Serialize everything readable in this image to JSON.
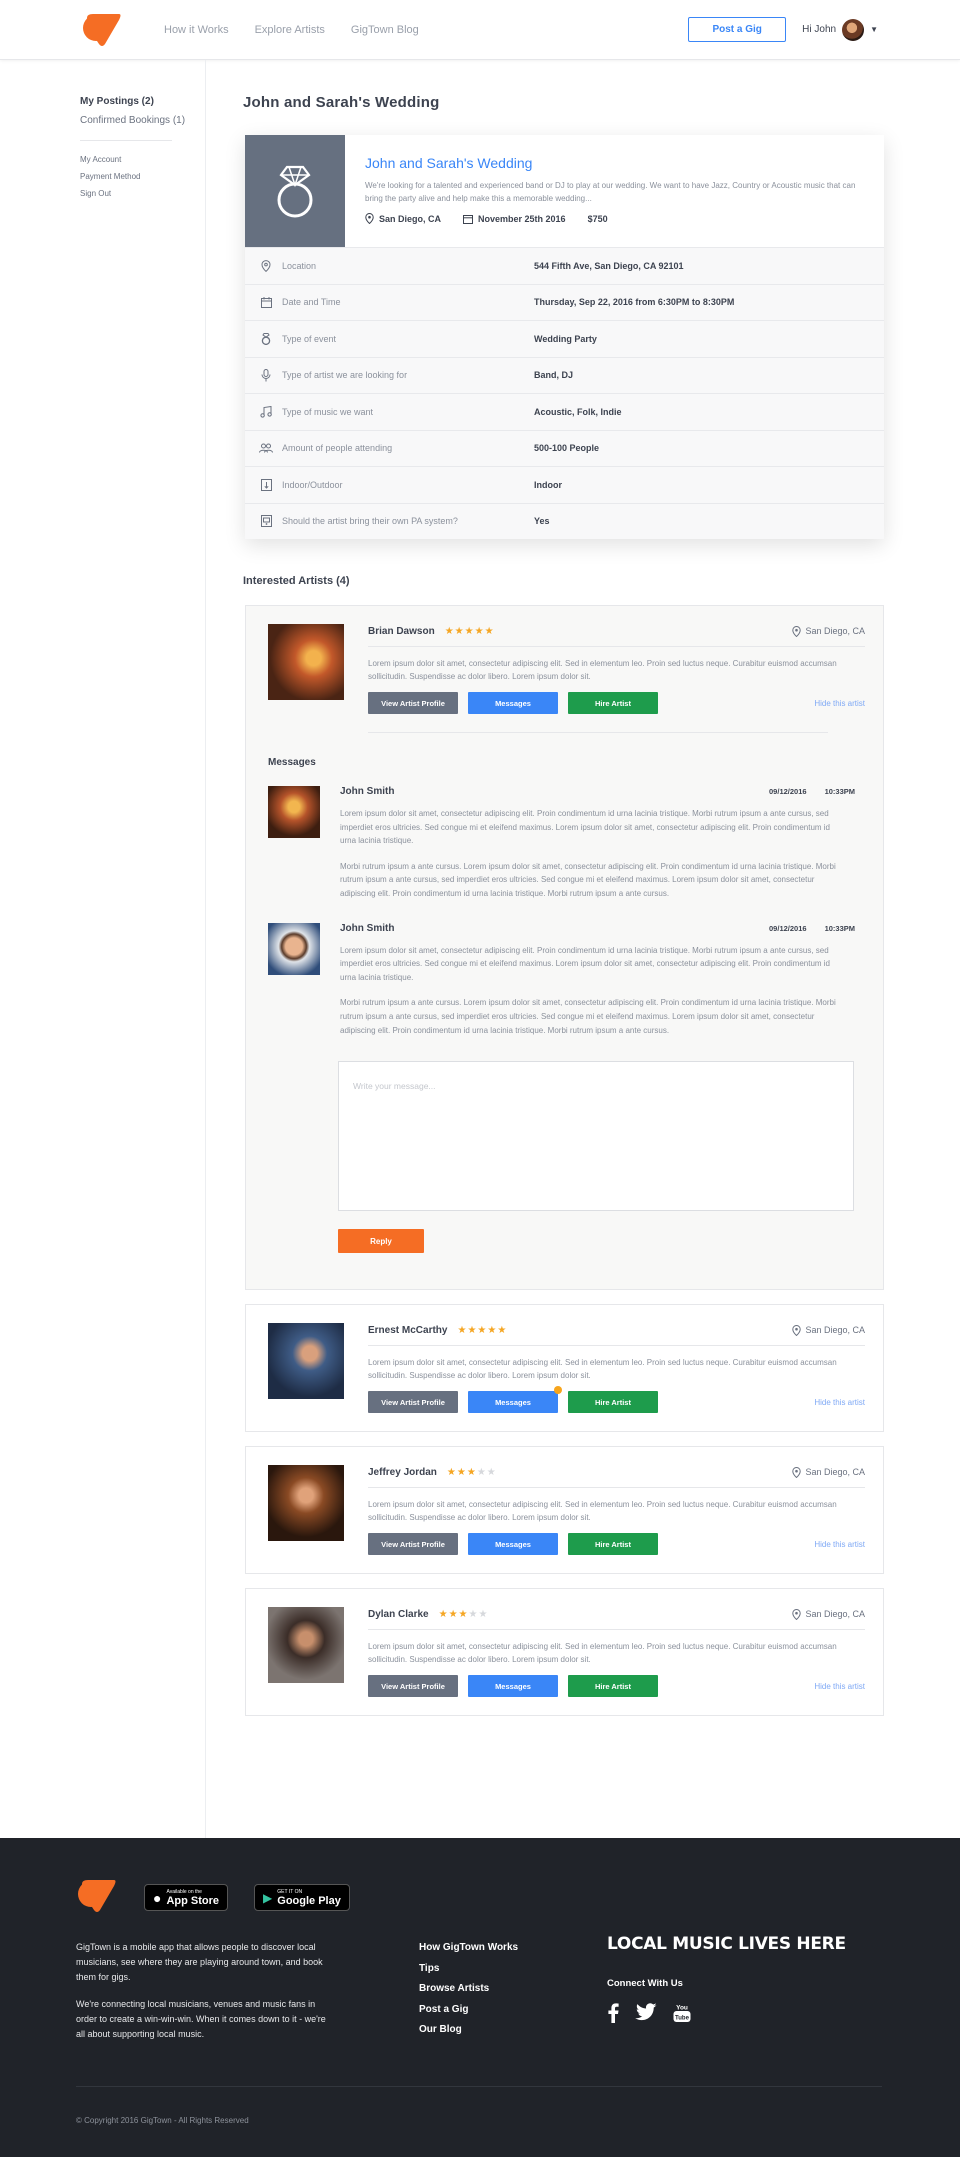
{
  "header": {
    "nav": [
      "How it Works",
      "Explore Artists",
      "GigTown Blog"
    ],
    "post_button": "Post a Gig",
    "greeting": "Hi John"
  },
  "sidebar": {
    "postings": "My Postings (2)",
    "bookings": "Confirmed Bookings (1)",
    "account_links": [
      "My Account",
      "Payment Method",
      "Sign Out"
    ]
  },
  "event": {
    "page_title": "John and Sarah's Wedding",
    "title": "John and Sarah's Wedding",
    "description": "We're looking for a talented and experienced band or DJ to play at our wedding. We want to have Jazz, Country or Acoustic music that can bring the party alive and help make this a memorable wedding...",
    "location": "San Diego, CA",
    "date": "November 25th 2016",
    "price": "$750",
    "details": [
      {
        "icon": "pin-icon",
        "label": "Location",
        "value": "544 Fifth Ave, San Diego, CA 92101"
      },
      {
        "icon": "calendar-icon",
        "label": "Date and Time",
        "value": "Thursday, Sep 22, 2016 from 6:30PM to 8:30PM"
      },
      {
        "icon": "ring-icon",
        "label": "Type of event",
        "value": "Wedding Party"
      },
      {
        "icon": "microphone-icon",
        "label": "Type of artist we are looking for",
        "value": "Band, DJ"
      },
      {
        "icon": "music-note-icon",
        "label": "Type of music we want",
        "value": "Acoustic, Folk, Indie"
      },
      {
        "icon": "people-icon",
        "label": "Amount of people attending",
        "value": "500-100 People"
      },
      {
        "icon": "indoor-outdoor-icon",
        "label": "Indoor/Outdoor",
        "value": "Indoor"
      },
      {
        "icon": "speaker-icon",
        "label": "Should the artist bring their own PA system?",
        "value": "Yes"
      }
    ]
  },
  "interested": {
    "title": "Interested Artists (4)",
    "buttons": {
      "profile": "View Artist Profile",
      "messages": "Messages",
      "hire": "Hire Artist",
      "hide": "Hide this artist"
    },
    "lorem": "Lorem ipsum dolor sit amet, consectetur adipiscing elit. Sed in elementum leo. Proin sed luctus neque. Curabitur euismod accumsan sollicitudin. Suspendisse ac dolor libero. Lorem ipsum dolor sit.",
    "artists": [
      {
        "name": "Brian Dawson",
        "rating": 5,
        "location": "San Diego, CA"
      },
      {
        "name": "Ernest McCarthy",
        "rating": 5,
        "location": "San Diego, CA"
      },
      {
        "name": "Jeffrey Jordan",
        "rating": 3,
        "location": "San Diego, CA"
      },
      {
        "name": "Dylan Clarke",
        "rating": 3,
        "location": "San Diego, CA"
      }
    ]
  },
  "messages": {
    "title": "Messages",
    "items": [
      {
        "name": "John Smith",
        "date": "09/12/2016",
        "time": "10:33PM",
        "p1": "Lorem ipsum dolor sit amet, consectetur adipiscing elit. Proin condimentum id urna lacinia tristique. Morbi rutrum ipsum a ante cursus, sed imperdiet eros ultricies. Sed congue mi et eleifend maximus. Lorem ipsum dolor sit amet, consectetur adipiscing elit. Proin condimentum id urna lacinia tristique.",
        "p2": "Morbi rutrum ipsum a ante cursus. Lorem ipsum dolor sit amet, consectetur adipiscing elit. Proin condimentum id urna lacinia tristique. Morbi rutrum ipsum a ante cursus, sed imperdiet eros ultricies. Sed congue mi et eleifend maximus. Lorem ipsum dolor sit amet, consectetur adipiscing elit. Proin condimentum id urna lacinia tristique. Morbi rutrum ipsum a ante cursus."
      },
      {
        "name": "John Smith",
        "date": "09/12/2016",
        "time": "10:33PM",
        "p1": "Lorem ipsum dolor sit amet, consectetur adipiscing elit. Proin condimentum id urna lacinia tristique. Morbi rutrum ipsum a ante cursus, sed imperdiet eros ultricies. Sed congue mi et eleifend maximus. Lorem ipsum dolor sit amet, consectetur adipiscing elit. Proin condimentum id urna lacinia tristique.",
        "p2": "Morbi rutrum ipsum a ante cursus. Lorem ipsum dolor sit amet, consectetur adipiscing elit. Proin condimentum id urna lacinia tristique. Morbi rutrum ipsum a ante cursus, sed imperdiet eros ultricies. Sed congue mi et eleifend maximus. Lorem ipsum dolor sit amet, consectetur adipiscing elit. Proin condimentum id urna lacinia tristique. Morbi rutrum ipsum a ante cursus."
      }
    ],
    "placeholder": "Write your message...",
    "reply": "Reply"
  },
  "footer": {
    "app_store_small": "Available on the",
    "app_store_big": "App Store",
    "google_small": "GET IT ON",
    "google_big": "Google Play",
    "about1": "GigTown is a mobile app that allows people to discover local musicians, see where they are playing around town, and book them for gigs.",
    "about2": "We're connecting local musicians, venues and music fans in order to create a win-win-win. When it comes down to it - we're all about supporting local music.",
    "links": [
      "How GigTown Works",
      "Tips",
      "Browse Artists",
      "Post a Gig",
      "Our Blog"
    ],
    "tagline": "LOCAL MUSIC LIVES HERE",
    "connect": "Connect With Us",
    "copyright": "© Copyright 2016 GigTown - All Rights Reserved"
  },
  "colors": {
    "brand_orange": "#f56d24",
    "accent_blue": "#3a86f7",
    "hire_green": "#1e9c4c",
    "footer_bg": "#202329"
  }
}
